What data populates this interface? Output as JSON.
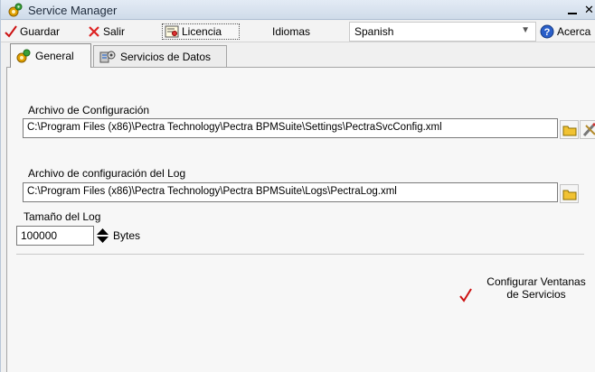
{
  "window": {
    "title": "Service Manager"
  },
  "toolbar": {
    "guardar_label": "Guardar",
    "salir_label": "Salir",
    "licencia_label": "Licencia",
    "idiomas_label": "Idiomas",
    "language_selected": "Spanish",
    "acerca_label": "Acerca"
  },
  "tabs": [
    {
      "label": "General",
      "icon": "gear-icon"
    },
    {
      "label": "Servicios de Datos",
      "icon": "services-icon"
    }
  ],
  "general": {
    "config_file_label": "Archivo de Configuración",
    "config_file_path": "C:\\Program Files (x86)\\Pectra Technology\\Pectra BPMSuite\\Settings\\PectraSvcConfig.xml",
    "log_config_label": "Archivo de configuración del Log",
    "log_file_path": "C:\\Program Files (x86)\\Pectra Technology\\Pectra BPMSuite\\Logs\\PectraLog.xml",
    "log_size_label": "Tamaño del Log",
    "log_size_value": "100000",
    "log_size_unit": "Bytes",
    "configure_windows_line1": "Configurar Ventanas",
    "configure_windows_line2": "de Servicios"
  },
  "colors": {
    "check": "#cc1111",
    "close_x": "#d22",
    "title_bg": "#d6e2f0"
  }
}
